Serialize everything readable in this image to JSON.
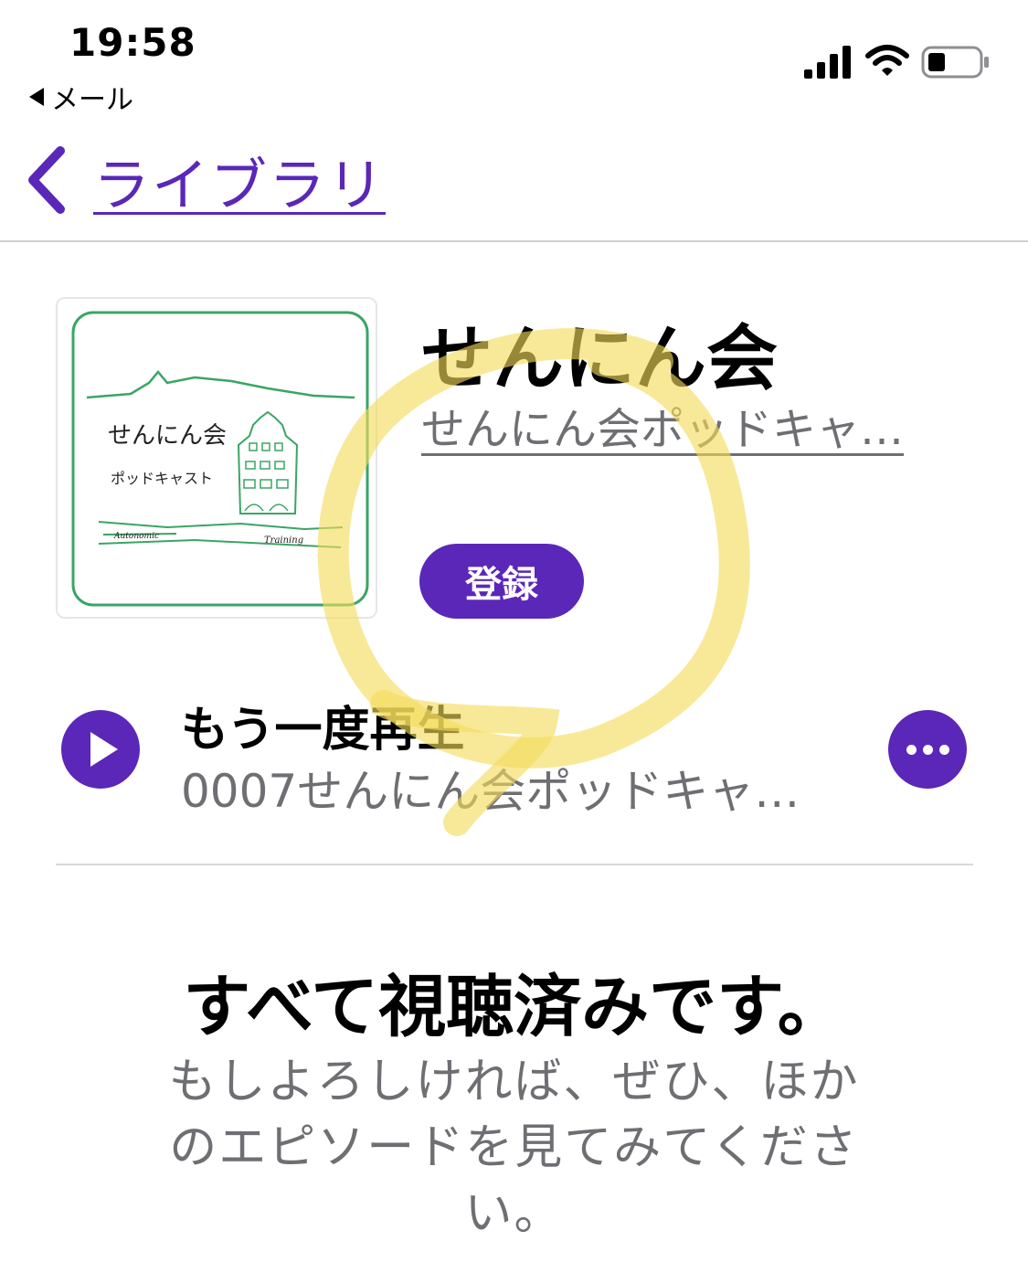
{
  "status_bar": {
    "time": "19:58",
    "back_app": "メール"
  },
  "nav": {
    "back_label": "ライブラリ",
    "back_icon": "chevron-left-icon"
  },
  "podcast": {
    "title": "せんにん会",
    "author": "せんにん会ポッドキャ…",
    "subscribe_label": "登録",
    "artwork": {
      "title_text": "せんにん会",
      "subtitle_text": "ポッドキャスト",
      "left_caption": "Autonomic",
      "right_caption": "Training"
    }
  },
  "replay": {
    "label": "もう一度再生",
    "episode": "0007せんにん会ポッドキャ…"
  },
  "empty_state": {
    "title": "すべて視聴済みです。",
    "body": "もしよろしければ、ぜひ、ほかのエピソードを見てみてください。"
  },
  "colors": {
    "accent": "#5b27b8",
    "secondary_text": "#6e6e73",
    "annotation": "#f3dc5a"
  }
}
